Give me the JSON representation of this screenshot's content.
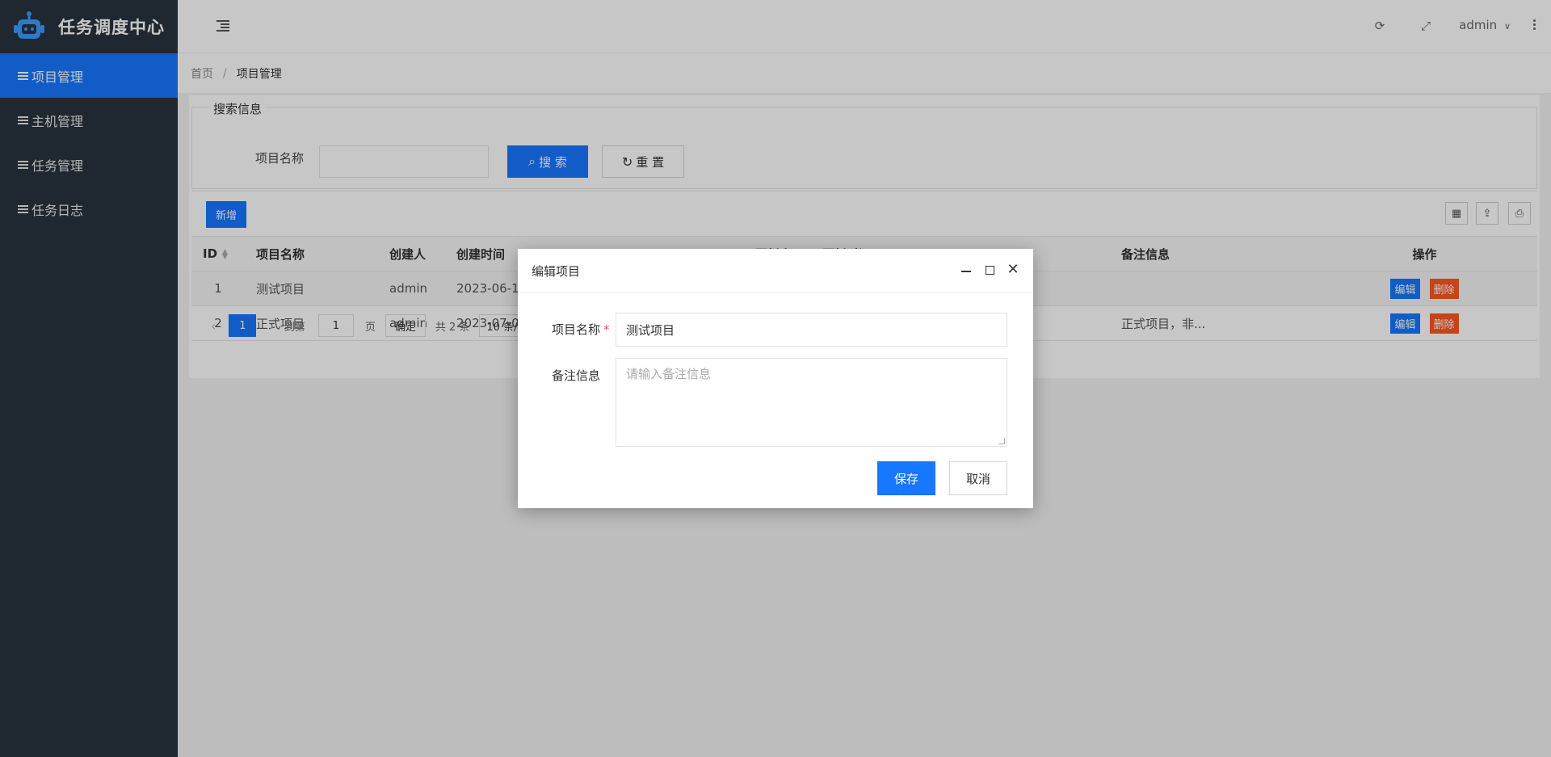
{
  "app": {
    "title": "任务调度中心"
  },
  "sidebar": {
    "items": [
      {
        "label": "项目管理",
        "active": true
      },
      {
        "label": "主机管理"
      },
      {
        "label": "任务管理"
      },
      {
        "label": "任务日志"
      }
    ]
  },
  "header": {
    "user": "admin"
  },
  "breadcrumb": {
    "home": "首页",
    "sep": "/",
    "current": "项目管理"
  },
  "search": {
    "legend": "搜索信息",
    "label": "项目名称",
    "value": "",
    "search_button": "搜 索",
    "reset_button": "重 置"
  },
  "toolbar": {
    "add_button": "新增"
  },
  "table": {
    "columns": [
      "ID",
      "项目名称",
      "创建人",
      "创建时间",
      "更新人",
      "更新时间",
      "备注信息",
      "操作"
    ],
    "rows": [
      {
        "id": "1",
        "name": "测试项目",
        "creator": "admin",
        "created": "2023-06-16",
        "note": ""
      },
      {
        "id": "2",
        "name": "正式项目",
        "creator": "admin",
        "created": "2023-07-01",
        "note": "正式项目，非..."
      }
    ],
    "edit_label": "编辑",
    "delete_label": "删除"
  },
  "pager": {
    "current_page": "1",
    "goto_label": "到第",
    "goto_value": "1",
    "page_unit": "页",
    "confirm": "确定",
    "total": "共 2 条",
    "page_size": "10 条/页"
  },
  "modal": {
    "title": "编辑项目",
    "name_label": "项目名称",
    "required_mark": "*",
    "name_value": "测试项目",
    "note_label": "备注信息",
    "note_placeholder": "请输入备注信息",
    "save_button": "保存",
    "cancel_button": "取消"
  },
  "colors": {
    "primary": "#1677ff",
    "danger": "#ff5722",
    "sidebar_bg": "#28333e"
  }
}
